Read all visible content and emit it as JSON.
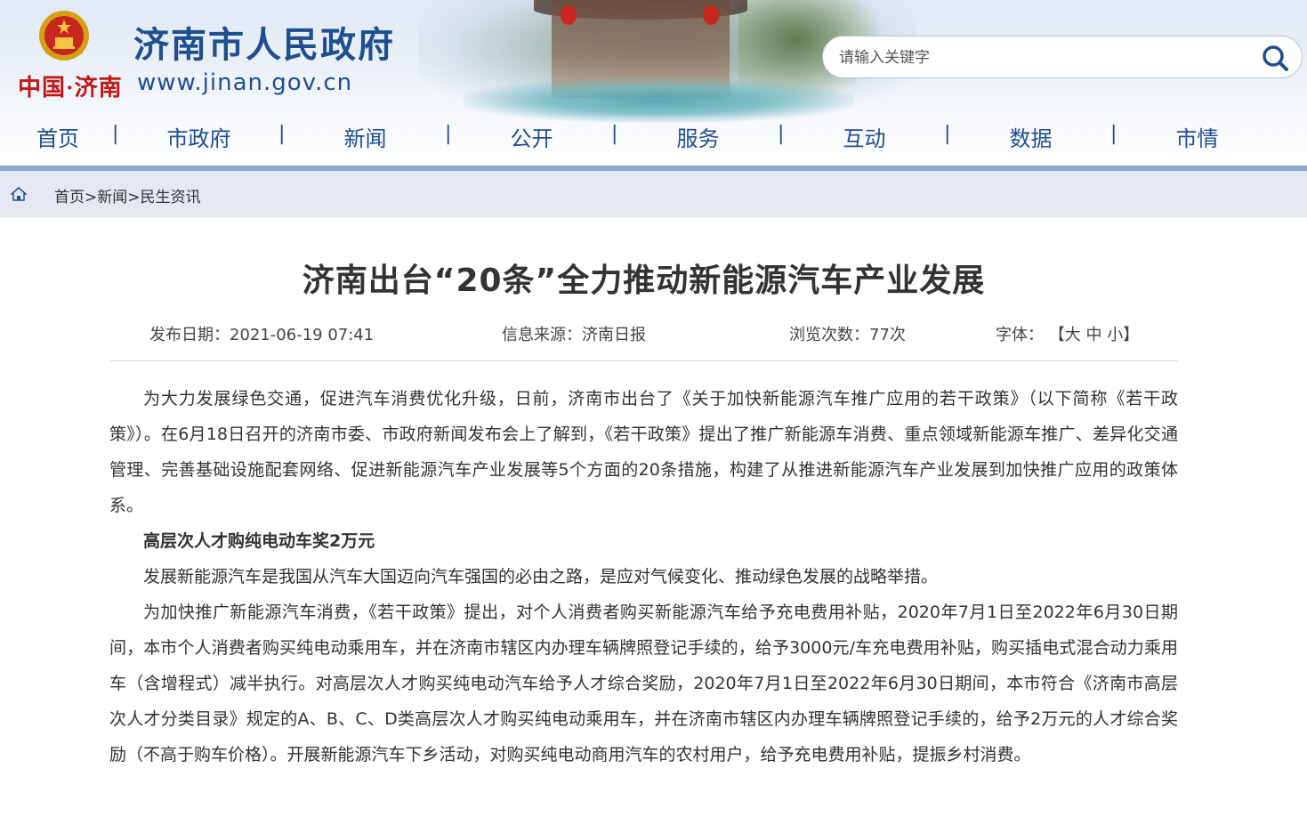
{
  "header": {
    "site_name": "济南市人民政府",
    "site_url": "www.jinan.gov.cn",
    "brand_small": "中国·济南",
    "emblem_icon": "national-emblem-icon"
  },
  "search": {
    "placeholder": "请输入关键字",
    "icon": "search-icon"
  },
  "nav": {
    "items": [
      "首页",
      "市政府",
      "新闻",
      "公开",
      "服务",
      "互动",
      "数据",
      "市情"
    ],
    "separator": "|"
  },
  "breadcrumb": {
    "home_icon": "home-icon",
    "items": [
      "首页",
      "新闻",
      "民生资讯"
    ],
    "separator": ">"
  },
  "article": {
    "title": "济南出台“20条”全力推动新能源汽车产业发展",
    "meta": {
      "publish_date": "发布日期：2021-06-19 07:41",
      "source": "信息来源：济南日报",
      "views": "浏览次数：77次",
      "font_label": "字体：",
      "font_open": "【",
      "font_large": "大",
      "font_medium": "中",
      "font_small": "小",
      "font_close": "】"
    },
    "paragraphs": [
      "为大力发展绿色交通，促进汽车消费优化升级，日前，济南市出台了《关于加快新能源汽车推广应用的若干政策》（以下简称《若干政策》）。在6月18日召开的济南市委、市政府新闻发布会上了解到，《若干政策》提出了推广新能源车消费、重点领域新能源车推广、差异化交通管理、完善基础设施配套网络、促进新能源汽车产业发展等5个方面的20条措施，构建了从推进新能源汽车产业发展到加快推广应用的政策体系。",
      "高层次人才购纯电动车奖2万元",
      "发展新能源汽车是我国从汽车大国迈向汽车强国的必由之路，是应对气候变化、推动绿色发展的战略举措。",
      "为加快推广新能源汽车消费，《若干政策》提出，对个人消费者购买新能源汽车给予充电费用补贴，2020年7月1日至2022年6月30日期间，本市个人消费者购买纯电动乘用车，并在济南市辖区内办理车辆牌照登记手续的，给予3000元/车充电费用补贴，购买插电式混合动力乘用车（含增程式）减半执行。对高层次人才购买纯电动汽车给予人才综合奖励，2020年7月1日至2022年6月30日期间，本市符合《济南市高层次人才分类目录》规定的A、B、C、D类高层次人才购买纯电动乘用车，并在济南市辖区内办理车辆牌照登记手续的，给予2万元的人才综合奖励（不高于购车价格）。开展新能源汽车下乡活动，对购买纯电动商用汽车的农村用户，给予充电费用补贴，提振乡村消费。"
    ]
  }
}
